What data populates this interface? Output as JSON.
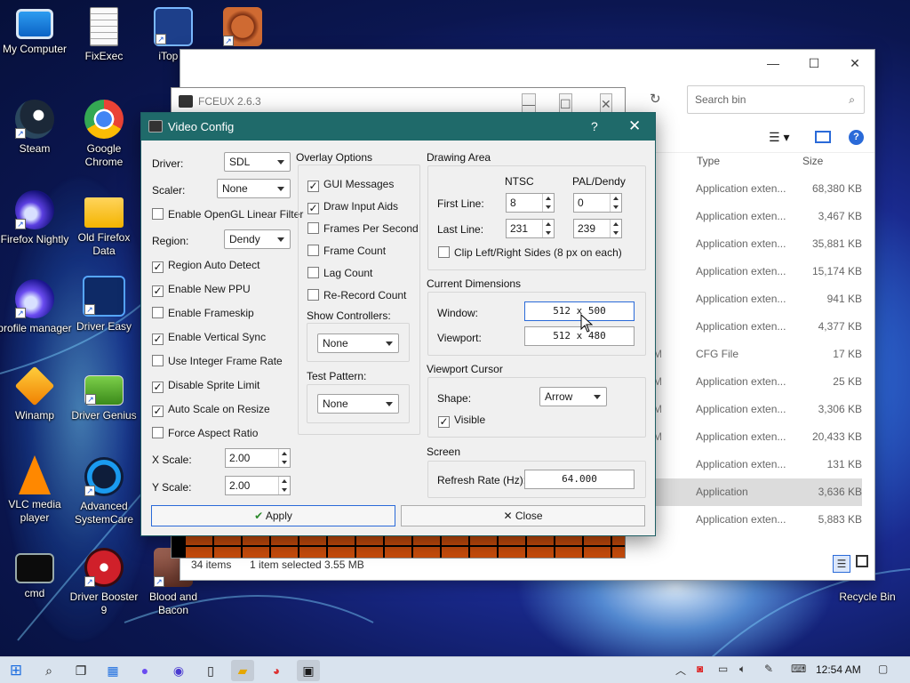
{
  "desktop": {
    "icons": [
      {
        "label": "My Computer"
      },
      {
        "label": "FixExec"
      },
      {
        "label": "iTop V"
      },
      {
        "label": ""
      },
      {
        "label": "Steam"
      },
      {
        "label": "Google Chrome"
      },
      {
        "label": "Firefox Nightly"
      },
      {
        "label": "Old Firefox Data"
      },
      {
        "label": "profile manager"
      },
      {
        "label": "Driver Easy"
      },
      {
        "label": "Winamp"
      },
      {
        "label": "Driver Genius"
      },
      {
        "label": "VLC media player"
      },
      {
        "label": "Advanced SystemCare"
      },
      {
        "label": "cmd"
      },
      {
        "label": "Driver Booster 9"
      },
      {
        "label": "Blood and Bacon"
      },
      {
        "label": "Recycle Bin"
      }
    ]
  },
  "explorer": {
    "search_placeholder": "Search bin",
    "columns": {
      "type": "Type",
      "size": "Size"
    },
    "rows": [
      {
        "type": "Application exten...",
        "size": "68,380 KB",
        "mark": ""
      },
      {
        "type": "Application exten...",
        "size": "3,467 KB",
        "mark": ""
      },
      {
        "type": "Application exten...",
        "size": "35,881 KB",
        "mark": ""
      },
      {
        "type": "Application exten...",
        "size": "15,174 KB",
        "mark": ""
      },
      {
        "type": "Application exten...",
        "size": "941 KB",
        "mark": ""
      },
      {
        "type": "Application exten...",
        "size": "4,377 KB",
        "mark": ""
      },
      {
        "type": "CFG File",
        "size": "17 KB",
        "mark": "M"
      },
      {
        "type": "Application exten...",
        "size": "25 KB",
        "mark": "M"
      },
      {
        "type": "Application exten...",
        "size": "3,306 KB",
        "mark": "M"
      },
      {
        "type": "Application exten...",
        "size": "20,433 KB",
        "mark": "M"
      },
      {
        "type": "Application exten...",
        "size": "131 KB",
        "mark": ""
      },
      {
        "type": "Application",
        "size": "3,636 KB",
        "mark": ""
      },
      {
        "type": "Application exten...",
        "size": "5,883 KB",
        "mark": ""
      }
    ],
    "status": {
      "items": "34 items",
      "selected": "1 item selected  3.55 MB"
    }
  },
  "fceux": {
    "title": "FCEUX 2.6.3"
  },
  "video_config": {
    "title": "Video Config",
    "help": "?",
    "left": {
      "driver_label": "Driver:",
      "driver_value": "SDL",
      "scaler_label": "Scaler:",
      "scaler_value": "None",
      "opengl_linear": "Enable OpenGL Linear Filter",
      "region_label": "Region:",
      "region_value": "Dendy",
      "checks": [
        {
          "label": "Region Auto Detect",
          "checked": true
        },
        {
          "label": "Enable New PPU",
          "checked": true
        },
        {
          "label": "Enable Frameskip",
          "checked": false
        },
        {
          "label": "Enable Vertical Sync",
          "checked": true
        },
        {
          "label": "Use Integer Frame Rate",
          "checked": false
        },
        {
          "label": "Disable Sprite Limit",
          "checked": true
        },
        {
          "label": "Auto Scale on Resize",
          "checked": true
        },
        {
          "label": "Force Aspect Ratio",
          "checked": false
        }
      ],
      "xscale_label": "X Scale:",
      "xscale_value": "2.00",
      "yscale_label": "Y Scale:",
      "yscale_value": "2.00"
    },
    "overlay": {
      "title": "Overlay Options",
      "checks": [
        {
          "label": "GUI Messages",
          "checked": true
        },
        {
          "label": "Draw Input Aids",
          "checked": true
        },
        {
          "label": "Frames Per Second",
          "checked": false
        },
        {
          "label": "Frame Count",
          "checked": false
        },
        {
          "label": "Lag Count",
          "checked": false
        },
        {
          "label": "Re-Record Count",
          "checked": false
        }
      ],
      "show_controllers_label": "Show Controllers:",
      "show_controllers_value": "None",
      "test_pattern_label": "Test Pattern:",
      "test_pattern_value": "None"
    },
    "drawing_area": {
      "title": "Drawing Area",
      "ntsc": "NTSC",
      "pal": "PAL/Dendy",
      "first_line_label": "First Line:",
      "first_ntsc": "8",
      "first_pal": "0",
      "last_line_label": "Last Line:",
      "last_ntsc": "231",
      "last_pal": "239",
      "clip": "Clip Left/Right Sides (8 px on each)"
    },
    "current_dimensions": {
      "title": "Current Dimensions",
      "window_label": "Window:",
      "window_value": "512 x 500",
      "viewport_label": "Viewport:",
      "viewport_value": "512 x 480"
    },
    "viewport_cursor": {
      "title": "Viewport Cursor",
      "shape_label": "Shape:",
      "shape_value": "Arrow",
      "visible": "Visible"
    },
    "screen": {
      "title": "Screen",
      "refresh_label": "Refresh Rate (Hz):",
      "refresh_value": "64.000"
    },
    "apply": "Apply",
    "close": "Close"
  },
  "taskbar": {
    "clock": "12:54 AM"
  }
}
